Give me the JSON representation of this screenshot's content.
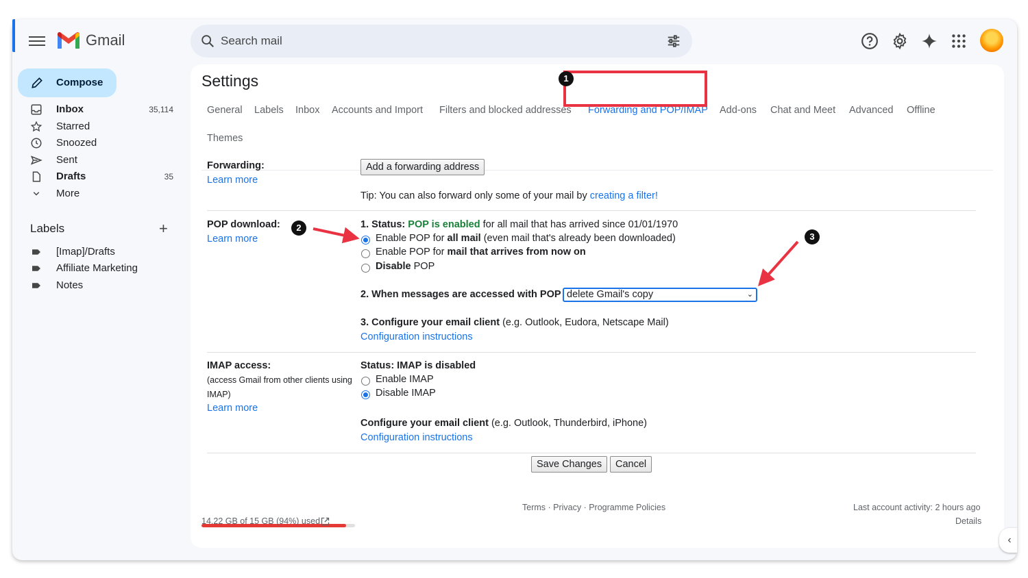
{
  "app": {
    "name": "Gmail"
  },
  "search": {
    "placeholder": "Search mail"
  },
  "compose": {
    "label": "Compose"
  },
  "sidebar": {
    "items": [
      {
        "label": "Inbox",
        "count": "35,114",
        "icon": "inbox-icon",
        "bold": true
      },
      {
        "label": "Starred",
        "count": "",
        "icon": "star-icon",
        "bold": false
      },
      {
        "label": "Snoozed",
        "count": "",
        "icon": "clock-icon",
        "bold": false
      },
      {
        "label": "Sent",
        "count": "",
        "icon": "send-icon",
        "bold": false
      },
      {
        "label": "Drafts",
        "count": "35",
        "icon": "file-icon",
        "bold": true
      },
      {
        "label": "More",
        "count": "",
        "icon": "chevron-down-icon",
        "bold": false
      }
    ],
    "labels_title": "Labels",
    "labels": [
      "[Imap]/Drafts",
      "Affiliate Marketing",
      "Notes"
    ]
  },
  "settings": {
    "title": "Settings",
    "tabs": [
      "General",
      "Labels",
      "Inbox",
      "Accounts and Import",
      "Filters and blocked addresses",
      "Forwarding and POP/IMAP",
      "Add-ons",
      "Chat and Meet",
      "Advanced",
      "Offline",
      "Themes"
    ],
    "active_tab": "Forwarding and POP/IMAP",
    "forwarding": {
      "label": "Forwarding:",
      "learn_more": "Learn more",
      "button": "Add a forwarding address",
      "tip_prefix": "Tip: You can also forward only some of your mail by ",
      "tip_link": "creating a filter!"
    },
    "pop": {
      "label": "POP download:",
      "learn_more": "Learn more",
      "status_prefix": "1. Status: ",
      "status_value": "POP is enabled",
      "status_suffix": " for all mail that has arrived since 01/01/1970",
      "options": [
        {
          "pre": "Enable POP for ",
          "bold": "all mail",
          "post": " (even mail that's already been downloaded)",
          "selected": true
        },
        {
          "pre": "Enable POP for ",
          "bold": "mail that arrives from now on",
          "post": "",
          "selected": false
        },
        {
          "pre": "",
          "bold": "Disable",
          "post": " POP",
          "selected": false
        }
      ],
      "when_label": "2. When messages are accessed with POP",
      "when_value": "delete Gmail's copy",
      "configure_bold": "3. Configure your email client",
      "configure_rest": " (e.g. Outlook, Eudora, Netscape Mail)",
      "config_link": "Configuration instructions"
    },
    "imap": {
      "label": "IMAP access:",
      "sub1": "(access Gmail from other clients using",
      "sub2": "IMAP)",
      "learn_more": "Learn more",
      "status": "Status: IMAP is disabled",
      "options": [
        {
          "label": "Enable IMAP",
          "selected": false
        },
        {
          "label": "Disable IMAP",
          "selected": true
        }
      ],
      "configure_bold": "Configure your email client",
      "configure_rest": " (e.g. Outlook, Thunderbird, iPhone)",
      "config_link": "Configuration instructions"
    },
    "save": "Save Changes",
    "cancel": "Cancel"
  },
  "footer": {
    "storage_text": "14.22 GB of 15 GB (94%) used",
    "storage_fraction": 0.94,
    "links": "Terms · Privacy · Programme Policies",
    "activity": "Last account activity: 2 hours ago",
    "details": "Details"
  },
  "annotations": {
    "badges": [
      "1",
      "2",
      "3"
    ],
    "color": "#ea3342"
  },
  "colors": {
    "accent": "#1a73e8",
    "compose": "#c2e7ff",
    "status_green": "#188038"
  }
}
